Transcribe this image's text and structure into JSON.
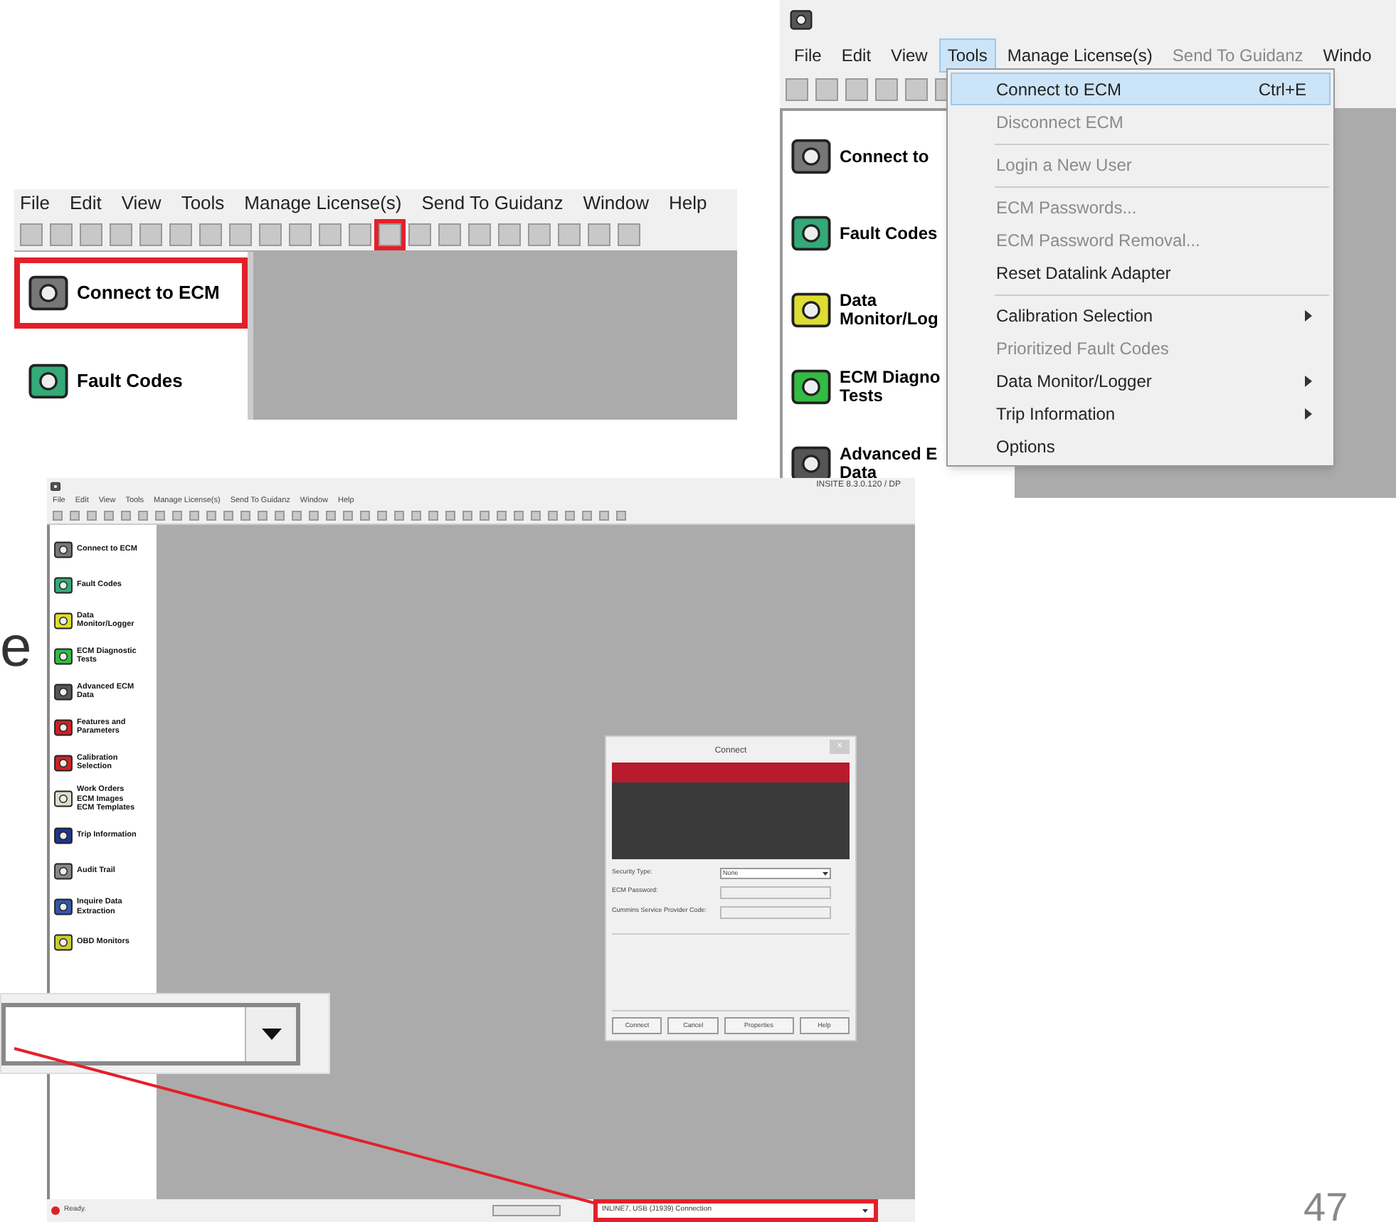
{
  "slide_text": "e",
  "page_number": "47",
  "toolbar_snippet": {
    "menu": [
      "File",
      "Edit",
      "View",
      "Tools",
      "Manage License(s)",
      "Send To Guidanz",
      "Window",
      "Help"
    ],
    "sidebar": [
      {
        "label": "Connect to ECM",
        "highlighted": true
      },
      {
        "label": "Fault Codes",
        "highlighted": false
      }
    ]
  },
  "menu_snippet": {
    "menu": [
      {
        "label": "File",
        "selected": false,
        "disabled": false
      },
      {
        "label": "Edit",
        "selected": false,
        "disabled": false
      },
      {
        "label": "View",
        "selected": false,
        "disabled": false
      },
      {
        "label": "Tools",
        "selected": true,
        "disabled": false
      },
      {
        "label": "Manage License(s)",
        "selected": false,
        "disabled": false
      },
      {
        "label": "Send To Guidanz",
        "selected": false,
        "disabled": true
      },
      {
        "label": "Windo",
        "selected": false,
        "disabled": false
      }
    ],
    "sidebar": [
      {
        "lines": [
          "Connect to"
        ]
      },
      {
        "lines": [
          "Fault Codes"
        ]
      },
      {
        "lines": [
          "Data",
          "Monitor/Log"
        ]
      },
      {
        "lines": [
          "ECM Diagno",
          "Tests"
        ]
      },
      {
        "lines": [
          "Advanced E",
          "Data"
        ]
      }
    ],
    "dropdown": [
      {
        "label": "Connect to ECM",
        "shortcut": "Ctrl+E",
        "selected": true,
        "disabled": false,
        "submenu": false,
        "separator_before": false
      },
      {
        "label": "Disconnect ECM",
        "selected": false,
        "disabled": true,
        "submenu": false,
        "separator_before": false
      },
      {
        "label": "Login a New User",
        "selected": false,
        "disabled": true,
        "submenu": false,
        "separator_before": true
      },
      {
        "label": "ECM Passwords...",
        "selected": false,
        "disabled": true,
        "submenu": false,
        "separator_before": true
      },
      {
        "label": "ECM Password Removal...",
        "selected": false,
        "disabled": true,
        "submenu": false,
        "separator_before": false
      },
      {
        "label": "Reset Datalink Adapter",
        "selected": false,
        "disabled": false,
        "submenu": false,
        "separator_before": false
      },
      {
        "label": "Calibration Selection",
        "selected": false,
        "disabled": false,
        "submenu": true,
        "separator_before": true
      },
      {
        "label": "Prioritized Fault Codes",
        "selected": false,
        "disabled": true,
        "submenu": false,
        "separator_before": false
      },
      {
        "label": "Data Monitor/Logger",
        "selected": false,
        "disabled": false,
        "submenu": true,
        "separator_before": false
      },
      {
        "label": "Trip Information",
        "selected": false,
        "disabled": false,
        "submenu": true,
        "separator_before": false
      },
      {
        "label": "Options",
        "selected": false,
        "disabled": false,
        "submenu": false,
        "separator_before": false
      }
    ]
  },
  "main_window": {
    "title": "INSITE 8.3.0.120 / DP",
    "menu": [
      "File",
      "Edit",
      "View",
      "Tools",
      "Manage License(s)",
      "Send To Guidanz",
      "Window",
      "Help"
    ],
    "sidebar": [
      {
        "lines": [
          "Connect to ECM"
        ]
      },
      {
        "lines": [
          "Fault Codes"
        ]
      },
      {
        "lines": [
          "Data",
          "Monitor/Logger"
        ]
      },
      {
        "lines": [
          "ECM Diagnostic",
          "Tests"
        ]
      },
      {
        "lines": [
          "Advanced ECM",
          "Data"
        ]
      },
      {
        "lines": [
          "Features and",
          "Parameters"
        ]
      },
      {
        "lines": [
          "Calibration",
          "Selection"
        ]
      },
      {
        "lines": [
          "Work Orders",
          "ECM Images",
          "ECM Templates"
        ]
      },
      {
        "lines": [
          "Trip Information"
        ]
      },
      {
        "lines": [
          "Audit Trail"
        ]
      },
      {
        "lines": [
          "Inquire Data",
          "Extraction"
        ]
      },
      {
        "lines": [
          "OBD Monitors"
        ]
      }
    ],
    "dialog": {
      "title": "Connect",
      "close": "×",
      "fields": [
        {
          "kind": "select",
          "label": "Security Type:",
          "value": "None"
        },
        {
          "kind": "text",
          "label": "ECM Password:"
        },
        {
          "kind": "text",
          "label": "Cummins Service Provider Code:"
        }
      ],
      "buttons": [
        "Connect",
        "Cancel",
        "Properties",
        "Help"
      ]
    },
    "status": "Ready.",
    "connection": "INLINE7, USB (J1939) Connection"
  }
}
